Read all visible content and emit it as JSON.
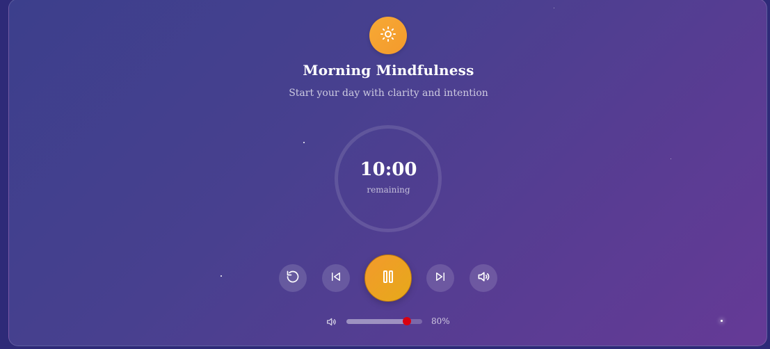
{
  "session": {
    "title": "Morning Mindfulness",
    "subtitle": "Start your day with clarity and intention",
    "icon": "sun-icon"
  },
  "timer": {
    "value": "10:00",
    "label": "remaining",
    "progress": 0
  },
  "controls": {
    "restart_icon": "restart-icon",
    "previous_icon": "skip-back-icon",
    "pause_icon": "pause-icon",
    "next_icon": "skip-forward-icon",
    "volume_icon": "volume-icon"
  },
  "volume": {
    "level": 80,
    "display": "80%",
    "icon": "volume-small-icon"
  },
  "colors": {
    "accent": "#f39a2c",
    "slider_thumb": "#d90010"
  }
}
